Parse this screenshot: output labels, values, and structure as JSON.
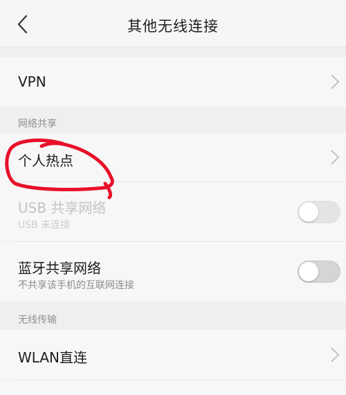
{
  "header": {
    "title": "其他无线连接",
    "back_icon": "chevron-left-icon"
  },
  "rows": {
    "vpn": {
      "label": "VPN"
    },
    "hotspot": {
      "label": "个人热点"
    },
    "usb": {
      "label": "USB 共享网络",
      "sub": "USB 未连接",
      "enabled": false,
      "on": false
    },
    "bluetooth": {
      "label": "蓝牙共享网络",
      "sub": "不共享该手机的互联网连接",
      "enabled": true,
      "on": false
    },
    "wlan_direct": {
      "label": "WLAN直连"
    }
  },
  "sections": {
    "network_sharing": "网络共享",
    "wireless_transfer": "无线传输"
  },
  "colors": {
    "annotation_red": "#e8102a",
    "chevron": "#b9b9b9"
  }
}
